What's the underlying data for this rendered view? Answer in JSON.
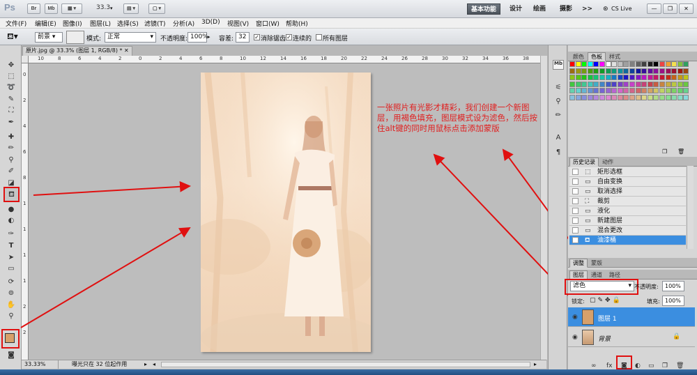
{
  "appbar": {
    "logo": "Ps",
    "buttons": [
      "Br",
      "Mb"
    ],
    "zoom": "33.3",
    "workspaces": [
      "基本功能",
      "设计",
      "绘画",
      "摄影"
    ],
    "more": ">>",
    "cslive": "CS Live"
  },
  "menu": [
    "文件(F)",
    "编辑(E)",
    "图像(I)",
    "图层(L)",
    "选择(S)",
    "滤镜(T)",
    "分析(A)",
    "3D(D)",
    "视图(V)",
    "窗口(W)",
    "帮助(H)"
  ],
  "options": {
    "fill_source": "前景",
    "mode_label": "模式:",
    "mode_value": "正常",
    "opacity_label": "不透明度:",
    "opacity_value": "100%",
    "tolerance_label": "容差:",
    "tolerance_value": "32",
    "antialias": "消除锯齿",
    "contiguous": "连续的",
    "all_layers": "所有图层"
  },
  "document": {
    "tab": "原片.jpg @ 33.3% (图层 1, RGB/8) *",
    "zoom_status": "33.33%",
    "status_text": "曝光只在 32 位起作用",
    "ruler_top": [
      "10",
      "8",
      "6",
      "4",
      "2",
      "0",
      "2",
      "4",
      "6",
      "8",
      "10",
      "12",
      "14",
      "16",
      "18",
      "20",
      "22",
      "24",
      "26",
      "28",
      "30",
      "32",
      "34",
      "36",
      "38"
    ],
    "ruler_left": [
      "0",
      "2",
      "4",
      "6",
      "8",
      "1",
      "1",
      "1",
      "1",
      "2",
      "2"
    ]
  },
  "annotation": "一张照片有光影才精彩，我们创建一个新图层，用褐色填充，图层模式设为滤色，然后按住alt键的同时用鼠标点击添加蒙版",
  "colors": {
    "accent": "#3b8ee0",
    "annotation_red": "#e02020",
    "foreground": "#d7a06a",
    "background": "#1a1a1a",
    "layer_fill": "#d7a06a"
  },
  "panels": {
    "color_tabs": [
      "颜色",
      "色板",
      "样式"
    ],
    "history_tabs": [
      "历史记录",
      "动作"
    ],
    "history": [
      "矩形选框",
      "自由变换",
      "取消选择",
      "裁剪",
      "液化",
      "新建图层",
      "混合更改",
      "油漆桶"
    ],
    "adjust_tabs": [
      "调整",
      "蒙版"
    ],
    "layer_tabs": [
      "图层",
      "通道",
      "路径"
    ],
    "blend_mode": "滤色",
    "opacity_label": "不透明度:",
    "opacity_value": "100%",
    "lock_label": "锁定:",
    "fill_label": "填充:",
    "fill_value": "100%",
    "layers": [
      {
        "name": "图层 1",
        "selected": true
      },
      {
        "name": "背景",
        "selected": false
      }
    ]
  }
}
